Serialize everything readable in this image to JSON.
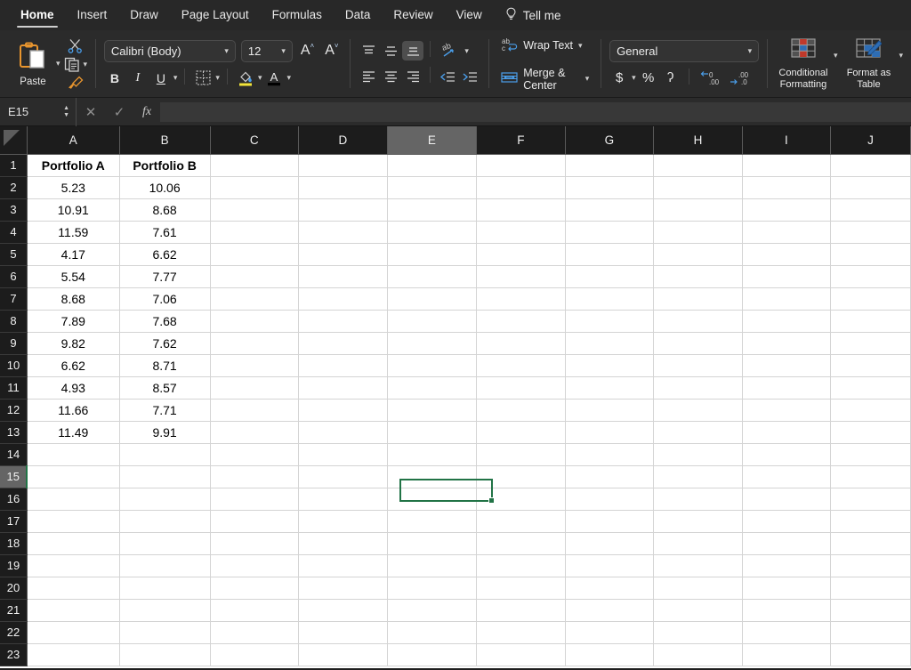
{
  "menubar": {
    "items": [
      {
        "label": "Home",
        "active": true
      },
      {
        "label": "Insert",
        "active": false
      },
      {
        "label": "Draw",
        "active": false
      },
      {
        "label": "Page Layout",
        "active": false
      },
      {
        "label": "Formulas",
        "active": false
      },
      {
        "label": "Data",
        "active": false
      },
      {
        "label": "Review",
        "active": false
      },
      {
        "label": "View",
        "active": false
      }
    ],
    "tell_me": "Tell me"
  },
  "ribbon": {
    "paste_label": "Paste",
    "font_name": "Calibri (Body)",
    "font_size": "12",
    "bold": "B",
    "italic": "I",
    "underline": "U",
    "wrap_text": "Wrap Text",
    "merge_center": "Merge & Center",
    "number_format": "General",
    "currency": "$",
    "percent": "%",
    "comma": "ʔ",
    "conditional_formatting": "Conditional Formatting",
    "format_as_table": "Format as Table"
  },
  "formula_bar": {
    "name_box": "E15",
    "formula": ""
  },
  "grid": {
    "columns": [
      "A",
      "B",
      "C",
      "D",
      "E",
      "F",
      "G",
      "H",
      "I",
      "J"
    ],
    "selected_column": "E",
    "selected_row": 15,
    "active_cell": "E15",
    "selection_color": "#217346",
    "rows": [
      {
        "n": 1,
        "cells": [
          "Portfolio A",
          "Portfolio B",
          "",
          "",
          "",
          "",
          "",
          "",
          "",
          ""
        ],
        "bold": true
      },
      {
        "n": 2,
        "cells": [
          "5.23",
          "10.06",
          "",
          "",
          "",
          "",
          "",
          "",
          "",
          ""
        ]
      },
      {
        "n": 3,
        "cells": [
          "10.91",
          "8.68",
          "",
          "",
          "",
          "",
          "",
          "",
          "",
          ""
        ]
      },
      {
        "n": 4,
        "cells": [
          "11.59",
          "7.61",
          "",
          "",
          "",
          "",
          "",
          "",
          "",
          ""
        ]
      },
      {
        "n": 5,
        "cells": [
          "4.17",
          "6.62",
          "",
          "",
          "",
          "",
          "",
          "",
          "",
          ""
        ]
      },
      {
        "n": 6,
        "cells": [
          "5.54",
          "7.77",
          "",
          "",
          "",
          "",
          "",
          "",
          "",
          ""
        ]
      },
      {
        "n": 7,
        "cells": [
          "8.68",
          "7.06",
          "",
          "",
          "",
          "",
          "",
          "",
          "",
          ""
        ]
      },
      {
        "n": 8,
        "cells": [
          "7.89",
          "7.68",
          "",
          "",
          "",
          "",
          "",
          "",
          "",
          ""
        ]
      },
      {
        "n": 9,
        "cells": [
          "9.82",
          "7.62",
          "",
          "",
          "",
          "",
          "",
          "",
          "",
          ""
        ]
      },
      {
        "n": 10,
        "cells": [
          "6.62",
          "8.71",
          "",
          "",
          "",
          "",
          "",
          "",
          "",
          ""
        ]
      },
      {
        "n": 11,
        "cells": [
          "4.93",
          "8.57",
          "",
          "",
          "",
          "",
          "",
          "",
          "",
          ""
        ]
      },
      {
        "n": 12,
        "cells": [
          "11.66",
          "7.71",
          "",
          "",
          "",
          "",
          "",
          "",
          "",
          ""
        ]
      },
      {
        "n": 13,
        "cells": [
          "11.49",
          "9.91",
          "",
          "",
          "",
          "",
          "",
          "",
          "",
          ""
        ]
      },
      {
        "n": 14,
        "cells": [
          "",
          "",
          "",
          "",
          "",
          "",
          "",
          "",
          "",
          ""
        ]
      },
      {
        "n": 15,
        "cells": [
          "",
          "",
          "",
          "",
          "",
          "",
          "",
          "",
          "",
          ""
        ]
      },
      {
        "n": 16,
        "cells": [
          "",
          "",
          "",
          "",
          "",
          "",
          "",
          "",
          "",
          ""
        ]
      },
      {
        "n": 17,
        "cells": [
          "",
          "",
          "",
          "",
          "",
          "",
          "",
          "",
          "",
          ""
        ]
      },
      {
        "n": 18,
        "cells": [
          "",
          "",
          "",
          "",
          "",
          "",
          "",
          "",
          "",
          ""
        ]
      },
      {
        "n": 19,
        "cells": [
          "",
          "",
          "",
          "",
          "",
          "",
          "",
          "",
          "",
          ""
        ]
      },
      {
        "n": 20,
        "cells": [
          "",
          "",
          "",
          "",
          "",
          "",
          "",
          "",
          "",
          ""
        ]
      },
      {
        "n": 21,
        "cells": [
          "",
          "",
          "",
          "",
          "",
          "",
          "",
          "",
          "",
          ""
        ]
      },
      {
        "n": 22,
        "cells": [
          "",
          "",
          "",
          "",
          "",
          "",
          "",
          "",
          "",
          ""
        ]
      },
      {
        "n": 23,
        "cells": [
          "",
          "",
          "",
          "",
          "",
          "",
          "",
          "",
          "",
          ""
        ]
      }
    ]
  },
  "chart_data": {
    "type": "table",
    "title": "",
    "categories": [
      "Portfolio A",
      "Portfolio B"
    ],
    "series": [
      {
        "name": "Portfolio A",
        "values": [
          5.23,
          10.91,
          11.59,
          4.17,
          5.54,
          8.68,
          7.89,
          9.82,
          6.62,
          4.93,
          11.66,
          11.49
        ]
      },
      {
        "name": "Portfolio B",
        "values": [
          10.06,
          8.68,
          7.61,
          6.62,
          7.77,
          7.06,
          7.68,
          7.62,
          8.71,
          8.57,
          7.71,
          9.91
        ]
      }
    ]
  }
}
